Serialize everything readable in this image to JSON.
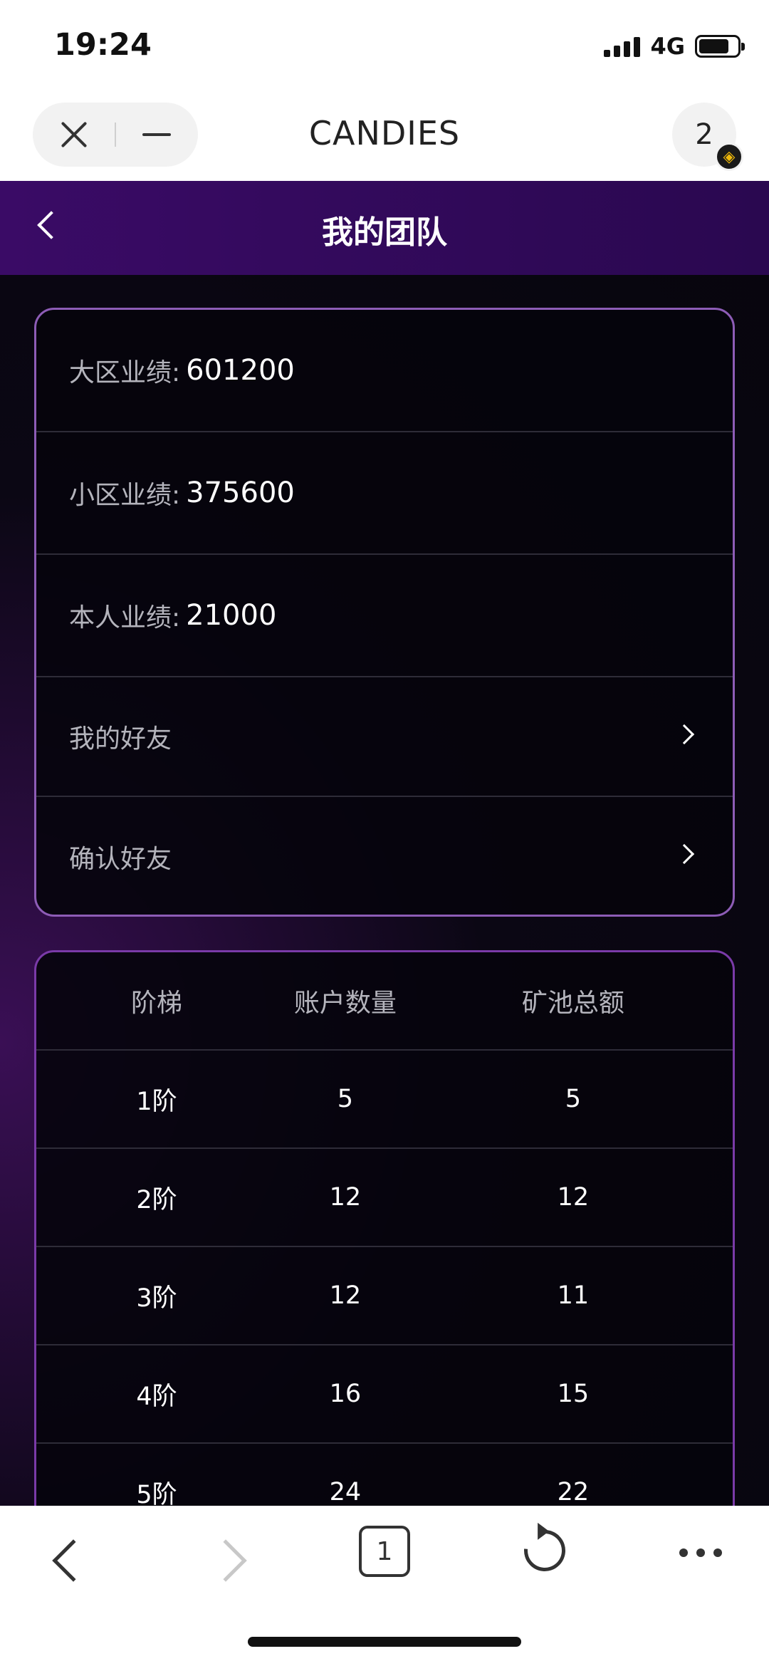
{
  "status_bar": {
    "time": "19:24",
    "network": "4G"
  },
  "browser": {
    "title": "CANDIES",
    "tab_count": "2",
    "tabs_button_count": "1"
  },
  "header": {
    "title": "我的团队"
  },
  "summary": {
    "rows": [
      {
        "label": "大区业绩:",
        "value": "601200"
      },
      {
        "label": "小区业绩:",
        "value": "375600"
      },
      {
        "label": "本人业绩:",
        "value": "21000"
      }
    ],
    "links": [
      {
        "label": "我的好友"
      },
      {
        "label": "确认好友"
      }
    ]
  },
  "tiers_table": {
    "headers": [
      "阶梯",
      "账户数量",
      "矿池总额"
    ],
    "rows": [
      [
        "1阶",
        "5",
        "5"
      ],
      [
        "2阶",
        "12",
        "12"
      ],
      [
        "3阶",
        "12",
        "11"
      ],
      [
        "4阶",
        "16",
        "15"
      ],
      [
        "5阶",
        "24",
        "22"
      ]
    ]
  },
  "icons": {
    "close": "close-icon",
    "minimize": "minus-icon",
    "back": "chevron-left-icon",
    "chevron": "chevron-right-icon",
    "reload": "reload-icon",
    "more": "more-icon"
  },
  "colors": {
    "header_bg": "#3a0b66",
    "card_border": "#8d5cb6",
    "app_bg": "#07050d"
  }
}
